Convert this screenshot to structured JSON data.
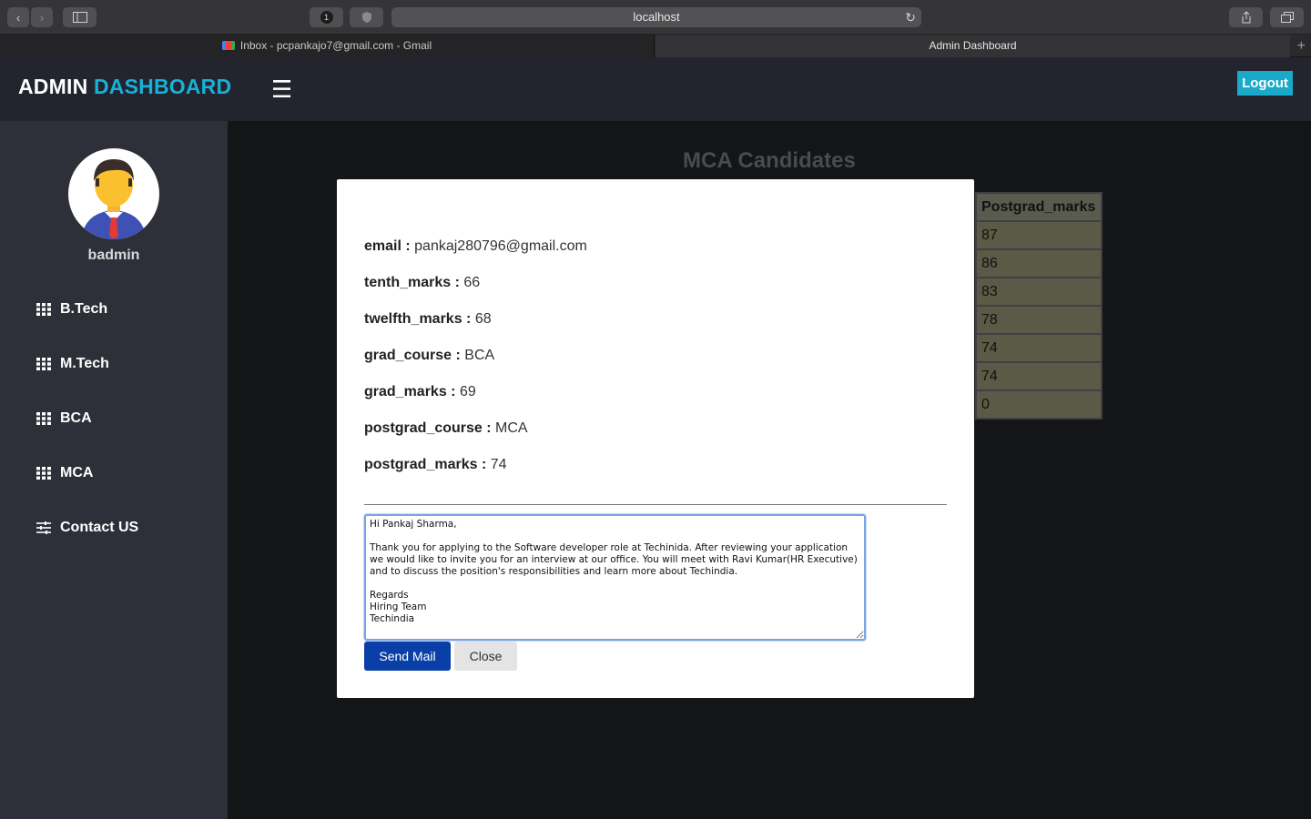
{
  "browser": {
    "url": "localhost",
    "tabs": [
      {
        "label": "Inbox - pcpankajo7@gmail.com - Gmail"
      },
      {
        "label": "Admin Dashboard"
      }
    ],
    "privacy_badge": "1"
  },
  "header": {
    "brand_main": "ADMIN",
    "brand_accent": "DASHBOARD",
    "logout_label": "Logout",
    "accent_color": "#19b0d8"
  },
  "sidebar": {
    "username": "badmin",
    "items": [
      {
        "label": "B.Tech",
        "icon": "grid-icon"
      },
      {
        "label": "M.Tech",
        "icon": "grid-icon"
      },
      {
        "label": "BCA",
        "icon": "grid-icon"
      },
      {
        "label": "MCA",
        "icon": "grid-icon"
      },
      {
        "label": "Contact US",
        "icon": "sliders-icon"
      }
    ]
  },
  "main": {
    "title": "MCA Candidates",
    "table": {
      "header": "Postgrad_marks",
      "rows": [
        "87",
        "86",
        "83",
        "78",
        "74",
        "74",
        "0"
      ]
    }
  },
  "modal": {
    "fields": [
      {
        "label": "email :",
        "value": "pankaj280796@gmail.com"
      },
      {
        "label": "tenth_marks :",
        "value": "66"
      },
      {
        "label": "twelfth_marks :",
        "value": "68"
      },
      {
        "label": "grad_course :",
        "value": "BCA"
      },
      {
        "label": "grad_marks :",
        "value": "69"
      },
      {
        "label": "postgrad_course :",
        "value": "MCA"
      },
      {
        "label": "postgrad_marks :",
        "value": "74"
      }
    ],
    "mail_body": "Hi Pankaj Sharma,\n\nThank you for applying to the Software developer role at Techinida. After reviewing your application we would like to invite you for an interview at our office. You will meet with Ravi Kumar(HR Executive) and to discuss the position's responsibilities and learn more about Techindia.\n\nRegards\nHiring Team\nTechindia",
    "send_label": "Send Mail",
    "close_label": "Close",
    "send_color": "#0b3fa8"
  }
}
